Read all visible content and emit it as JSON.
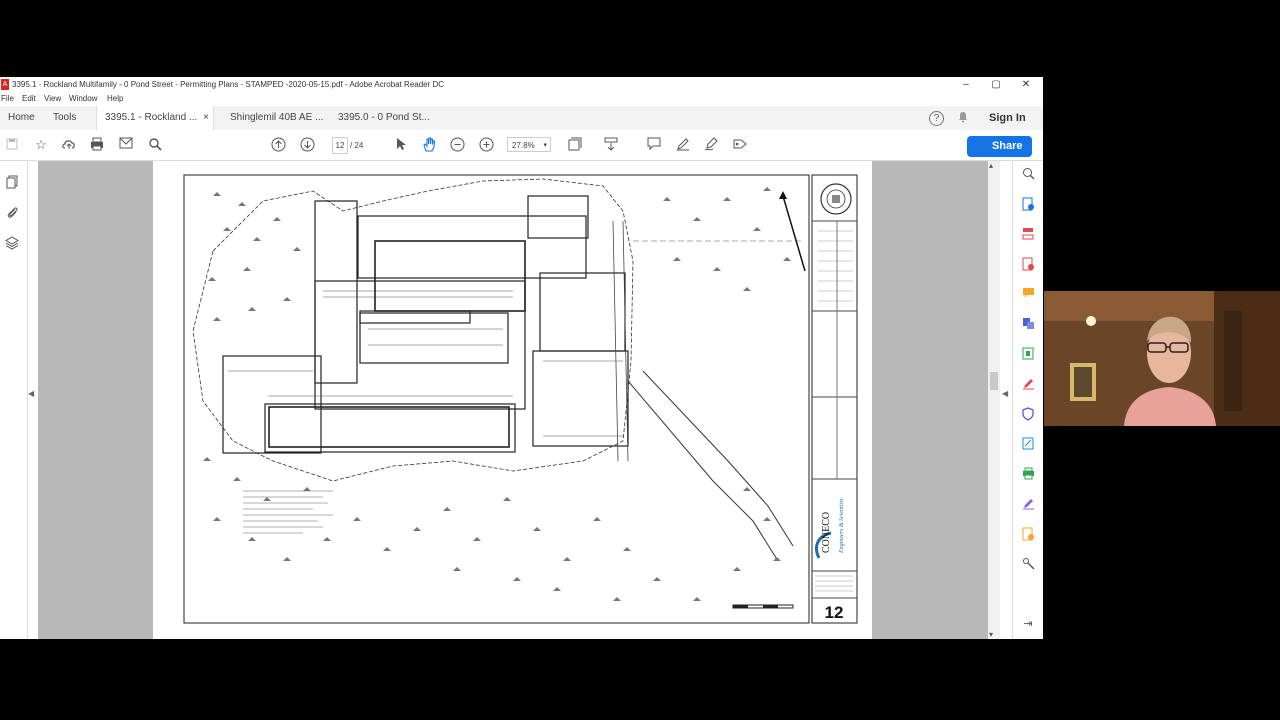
{
  "window": {
    "title": "3395.1 - Rockland Multifamily - 0 Pond Street - Permitting Plans - STAMPED -2020-05-15.pdf - Adobe Acrobat Reader DC",
    "controls": {
      "minimize": "–",
      "maximize": "▢",
      "close": "✕"
    }
  },
  "menu": [
    "File",
    "Edit",
    "View",
    "Window",
    "Help"
  ],
  "tabs": {
    "home": "Home",
    "tools": "Tools",
    "docs": [
      "3395.1 - Rockland ...",
      "Shinglemil 40B AE ...",
      "3395.0 - 0 Pond St..."
    ],
    "close": "×",
    "sign_in": "Sign In",
    "help": "?",
    "bell": "🔔"
  },
  "toolbar": {
    "page_current": "12",
    "page_total": "/ 24",
    "zoom": "27.8%",
    "share": "Share"
  },
  "drawing": {
    "sheet_number": "12",
    "firm_name": "CONECO",
    "firm_subtitle": "Engineers & Scientists"
  },
  "colors": {
    "share_blue": "#1473e6",
    "doc_gray": "#b8b8b8",
    "pdf_red": "#d8271c"
  }
}
